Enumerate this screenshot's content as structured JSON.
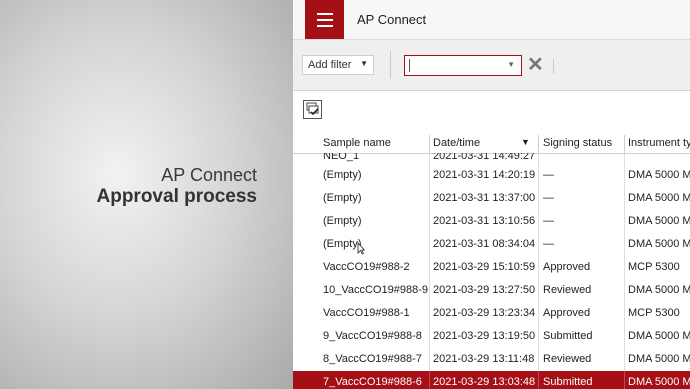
{
  "caption": {
    "title": "AP Connect",
    "subtitle": "Approval process"
  },
  "app": {
    "title": "AP Connect"
  },
  "filter": {
    "add_filter_label": "Add filter",
    "value": ""
  },
  "table": {
    "columns": {
      "sample_name": "Sample name",
      "date_time": "Date/time",
      "signing_status": "Signing status",
      "instrument_type": "Instrument ty"
    },
    "partial_row": {
      "sample_name": "NEO_1",
      "date_time": "2021-03-31 14:49:27"
    },
    "rows": [
      {
        "sample_name": "(Empty)",
        "date_time": "2021-03-31 14:20:19",
        "signing_status": "—",
        "instrument": "DMA 5000 M"
      },
      {
        "sample_name": "(Empty)",
        "date_time": "2021-03-31 13:37:00",
        "signing_status": "—",
        "instrument": "DMA 5000 M"
      },
      {
        "sample_name": "(Empty)",
        "date_time": "2021-03-31 13:10:56",
        "signing_status": "—",
        "instrument": "DMA 5000 M"
      },
      {
        "sample_name": "(Empty)",
        "date_time": "2021-03-31 08:34:04",
        "signing_status": "—",
        "instrument": "DMA 5000 M"
      },
      {
        "sample_name": "VaccCO19#988-2",
        "date_time": "2021-03-29 15:10:59",
        "signing_status": "Approved",
        "instrument": "MCP 5300"
      },
      {
        "sample_name": "10_VaccCO19#988-9",
        "date_time": "2021-03-29 13:27:50",
        "signing_status": "Reviewed",
        "instrument": "DMA 5000 M"
      },
      {
        "sample_name": "VaccCO19#988-1",
        "date_time": "2021-03-29 13:23:34",
        "signing_status": "Approved",
        "instrument": "MCP 5300"
      },
      {
        "sample_name": "9_VaccCO19#988-8",
        "date_time": "2021-03-29 13:19:50",
        "signing_status": "Submitted",
        "instrument": "DMA 5000 M"
      },
      {
        "sample_name": "8_VaccCO19#988-7",
        "date_time": "2021-03-29 13:11:48",
        "signing_status": "Reviewed",
        "instrument": "DMA 5000 M"
      },
      {
        "sample_name": "7_VaccCO19#988-6",
        "date_time": "2021-03-29 13:03:48",
        "signing_status": "Submitted",
        "instrument": "DMA 5000 M"
      }
    ]
  },
  "colors": {
    "accent": "#a50f16"
  }
}
